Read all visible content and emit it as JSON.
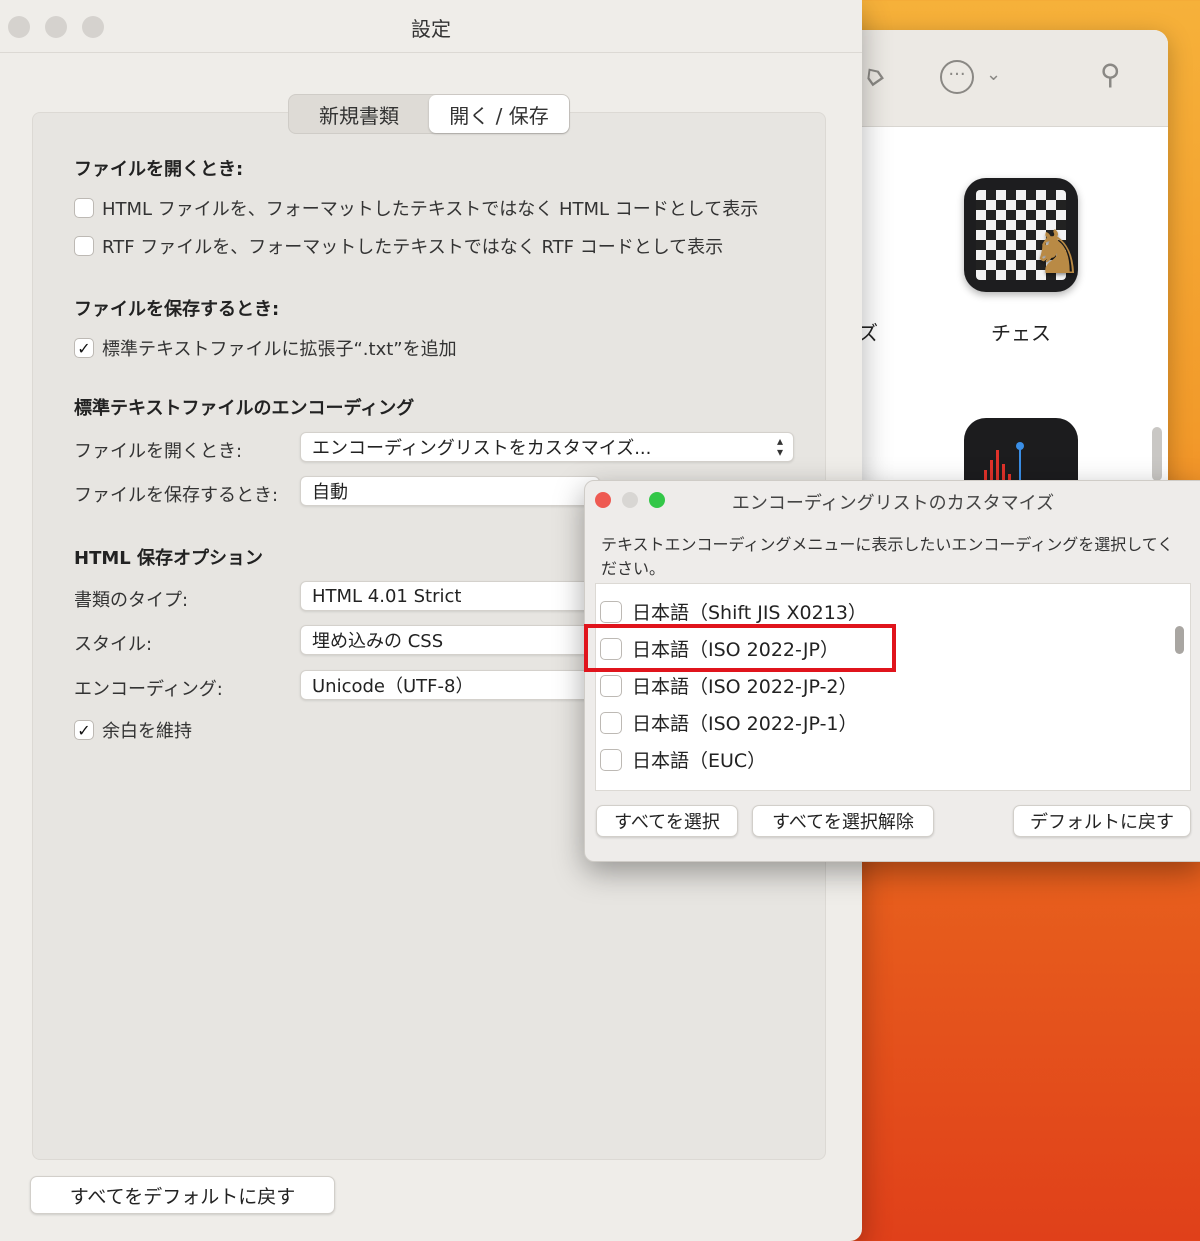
{
  "settings_window": {
    "title": "設定",
    "tabs": [
      {
        "label": "新規書類",
        "active": false
      },
      {
        "label": "開く / 保存",
        "active": true
      }
    ],
    "open_section": {
      "heading": "ファイルを開くとき:",
      "options": [
        {
          "label": "HTML ファイルを、フォーマットしたテキストではなく HTML コードとして表示",
          "checked": false
        },
        {
          "label": "RTF ファイルを、フォーマットしたテキストではなく RTF コードとして表示",
          "checked": false
        }
      ]
    },
    "save_section": {
      "heading": "ファイルを保存するとき:",
      "options": [
        {
          "label": "標準テキストファイルに拡張子“.txt”を追加",
          "checked": true
        }
      ]
    },
    "encoding_section": {
      "heading": "標準テキストファイルのエンコーディング",
      "open_label": "ファイルを開くとき:",
      "open_value": "エンコーディングリストをカスタマイズ...",
      "save_label": "ファイルを保存するとき:",
      "save_value": "自動"
    },
    "html_section": {
      "heading": "HTML 保存オプション",
      "doc_type_label": "書類のタイプ:",
      "doc_type_value": "HTML 4.01 Strict",
      "style_label": "スタイル:",
      "style_value": "埋め込みの CSS",
      "encoding_label": "エンコーディング:",
      "encoding_value": "Unicode（UTF-8）",
      "preserve_whitespace": {
        "label": "余白を維持",
        "checked": true
      }
    },
    "reset_all_label": "すべてをデフォルトに戻す"
  },
  "encoding_dialog": {
    "title": "エンコーディングリストのカスタマイズ",
    "description": "テキストエンコーディングメニューに表示したいエンコーディングを選択してください。",
    "items": [
      {
        "label": "日本語（Shift JIS X0213）",
        "checked": false
      },
      {
        "label": "日本語（ISO 2022-JP）",
        "checked": false
      },
      {
        "label": "日本語（ISO 2022-JP-2）",
        "checked": false
      },
      {
        "label": "日本語（ISO 2022-JP-1）",
        "checked": false
      },
      {
        "label": "日本語（EUC）",
        "checked": false
      }
    ],
    "highlighted_item": "日本語（ISO 2022-JP）",
    "buttons": {
      "select_all": "すべてを選択",
      "deselect_all": "すべてを選択解除",
      "restore_default": "デフォルトに戻す"
    }
  },
  "background_finder": {
    "apps": [
      {
        "label": "チェス",
        "icon": "chess-app-icon"
      },
      {
        "label": "ズ",
        "icon": "partial-app-icon"
      }
    ],
    "toolbar_icons": [
      "tag-icon",
      "more-options-icon",
      "chevron-down-icon",
      "search-icon"
    ]
  },
  "colors": {
    "highlight": "#e0141c",
    "close": "#ee5a52",
    "minimize": "#d8d6d3",
    "zoom": "#33c748"
  }
}
